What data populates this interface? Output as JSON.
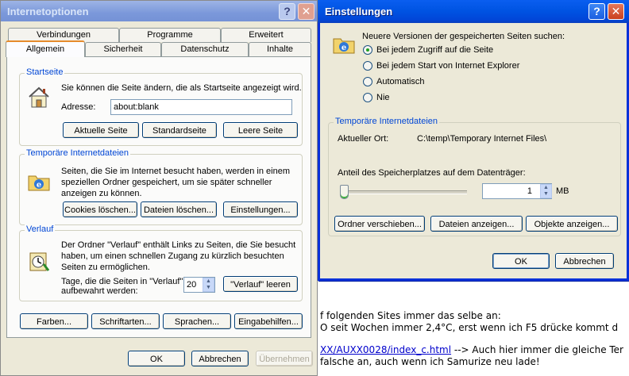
{
  "win1": {
    "title": "Internetoptionen",
    "tabs_row1": [
      "Verbindungen",
      "Programme",
      "Erweitert"
    ],
    "tabs_row2": [
      "Allgemein",
      "Sicherheit",
      "Datenschutz",
      "Inhalte"
    ],
    "startseite": {
      "legend": "Startseite",
      "desc": "Sie können die Seite ändern, die als Startseite angezeigt wird.",
      "address_label": "Adresse:",
      "address_value": "about:blank",
      "btn_current": "Aktuelle Seite",
      "btn_default": "Standardseite",
      "btn_blank": "Leere Seite"
    },
    "temp": {
      "legend": "Temporäre Internetdateien",
      "desc1": "Seiten, die Sie im Internet besucht haben, werden in einem",
      "desc2": "speziellen Ordner gespeichert, um sie später schneller",
      "desc3": "anzeigen zu können.",
      "btn_cookies": "Cookies löschen...",
      "btn_files": "Dateien löschen...",
      "btn_settings": "Einstellungen..."
    },
    "verlauf": {
      "legend": "Verlauf",
      "desc1": "Der Ordner \"Verlauf\" enthält Links zu Seiten, die Sie besucht",
      "desc2": "haben, um einen schnellen Zugang zu kürzlich besuchten",
      "desc3": "Seiten zu ermöglichen.",
      "days_label1": "Tage, die die Seiten in \"Verlauf\"",
      "days_label2": "aufbewahrt werden:",
      "days_value": "20",
      "btn_clear": "\"Verlauf\" leeren"
    },
    "bottom_buttons": [
      "Farben...",
      "Schriftarten...",
      "Sprachen...",
      "Eingabehilfen..."
    ],
    "btn_ok": "OK",
    "btn_cancel": "Abbrechen",
    "btn_apply": "Übernehmen"
  },
  "win2": {
    "title": "Einstellungen",
    "check_label": "Neuere Versionen der gespeicherten Seiten suchen:",
    "radios": [
      {
        "label": "Bei jedem Zugriff auf die Seite",
        "selected": true
      },
      {
        "label": "Bei jedem Start von Internet Explorer",
        "selected": false
      },
      {
        "label": "Automatisch",
        "selected": false
      },
      {
        "label": "Nie",
        "selected": false
      }
    ],
    "group_legend": "Temporäre Internetdateien",
    "location_label": "Aktueller Ort:",
    "location_value": "C:\\temp\\Temporary Internet Files\\",
    "space_label": "Anteil des Speicherplatzes auf dem Datenträger:",
    "space_value": "1",
    "space_unit": "MB",
    "slider_fraction": 0.0,
    "btn_move": "Ordner verschieben...",
    "btn_files": "Dateien anzeigen...",
    "btn_objects": "Objekte anzeigen...",
    "btn_ok": "OK",
    "btn_cancel": "Abbrechen"
  },
  "background_text": {
    "line1": "f folgenden Sites immer das selbe an:",
    "line2": "O seit Wochen immer 2,4°C, erst wenn ich F5 drücke kommt d",
    "line3_link": "XX/AUXX0028/index_c.html",
    "line3_rest": " --> Auch hier immer die gleiche Ter",
    "line4": "falsche an, auch wenn ich Samurize neu lade!"
  },
  "colors": {
    "accent_blue": "#0046d5",
    "link_blue": "#0000cc",
    "title_active": "#0054e3"
  }
}
